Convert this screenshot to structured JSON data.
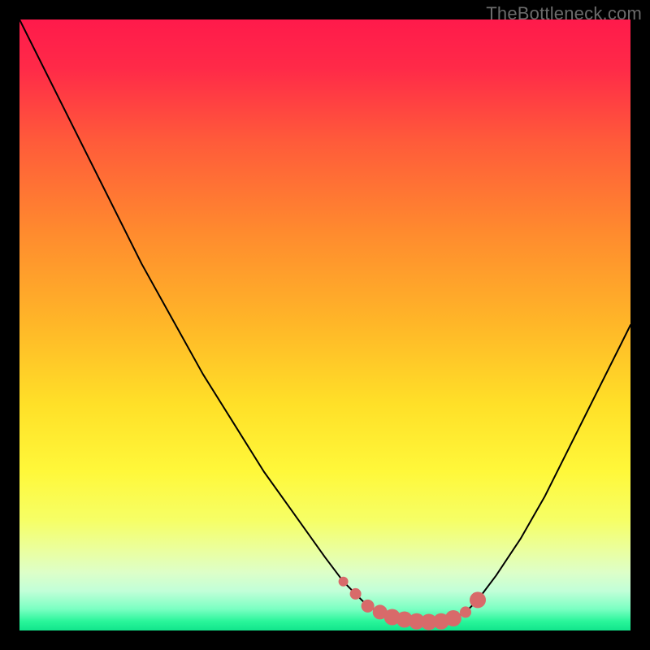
{
  "watermark": "TheBottleneck.com",
  "colors": {
    "frame": "#000000",
    "curve_stroke": "#000000",
    "marker": "#d86a6a",
    "gradient_stops": [
      {
        "offset": 0.0,
        "color": "#ff1a4b"
      },
      {
        "offset": 0.08,
        "color": "#ff2a48"
      },
      {
        "offset": 0.2,
        "color": "#ff5b3a"
      },
      {
        "offset": 0.35,
        "color": "#ff8b2e"
      },
      {
        "offset": 0.5,
        "color": "#ffb728"
      },
      {
        "offset": 0.63,
        "color": "#ffe028"
      },
      {
        "offset": 0.74,
        "color": "#fff83a"
      },
      {
        "offset": 0.82,
        "color": "#f6ff66"
      },
      {
        "offset": 0.87,
        "color": "#eaffa0"
      },
      {
        "offset": 0.905,
        "color": "#ddffc8"
      },
      {
        "offset": 0.935,
        "color": "#c2ffd8"
      },
      {
        "offset": 0.965,
        "color": "#7affc2"
      },
      {
        "offset": 0.985,
        "color": "#29f59a"
      },
      {
        "offset": 1.0,
        "color": "#12e58c"
      }
    ]
  },
  "chart_data": {
    "type": "line",
    "title": "",
    "xlabel": "",
    "ylabel": "",
    "xlim": [
      0,
      100
    ],
    "ylim": [
      0,
      100
    ],
    "series": [
      {
        "name": "bottleneck-curve",
        "x": [
          0,
          5,
          10,
          15,
          20,
          25,
          30,
          35,
          40,
          45,
          50,
          53,
          55,
          57,
          59,
          61,
          63,
          65,
          67,
          69,
          71,
          73,
          75,
          78,
          82,
          86,
          90,
          94,
          98,
          100
        ],
        "values": [
          100,
          90,
          80,
          70,
          60,
          51,
          42,
          34,
          26,
          19,
          12,
          8,
          6,
          4,
          3,
          2.2,
          1.8,
          1.5,
          1.4,
          1.5,
          2,
          3,
          5,
          9,
          15,
          22,
          30,
          38,
          46,
          50
        ]
      }
    ],
    "markers": {
      "name": "highlight-band",
      "x": [
        53,
        55,
        57,
        59,
        61,
        63,
        65,
        67,
        69,
        71,
        73,
        75
      ],
      "values": [
        8,
        6,
        4,
        3,
        2.2,
        1.8,
        1.5,
        1.4,
        1.5,
        2,
        3,
        5
      ],
      "radius": [
        6,
        7,
        8,
        9,
        10,
        10,
        10,
        10,
        10,
        10,
        7,
        10
      ]
    }
  }
}
